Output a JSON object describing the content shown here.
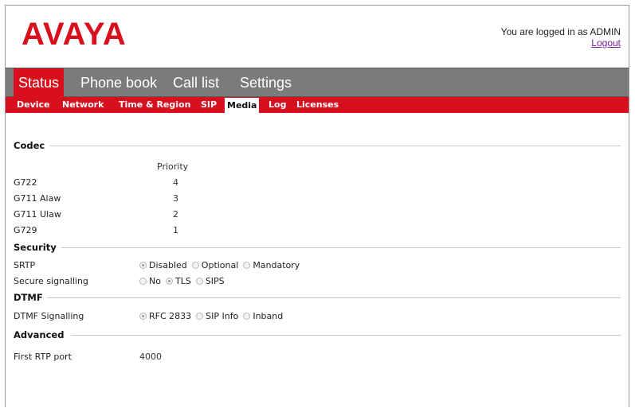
{
  "header": {
    "logo": "AVAYA",
    "login_text": "You are logged in as ADMIN",
    "logout": "Logout"
  },
  "main_tabs": [
    {
      "label": "Status",
      "active": true
    },
    {
      "label": "Phone book",
      "active": false
    },
    {
      "label": "Call list",
      "active": false
    },
    {
      "label": "Settings",
      "active": false
    }
  ],
  "sub_tabs": [
    {
      "label": "Device",
      "active": false
    },
    {
      "label": "Network",
      "active": false
    },
    {
      "label": "Time & Region",
      "active": false
    },
    {
      "label": "SIP",
      "active": false
    },
    {
      "label": "Media",
      "active": true
    },
    {
      "label": "Log",
      "active": false
    },
    {
      "label": "Licenses",
      "active": false
    }
  ],
  "codec": {
    "title": "Codec",
    "priority_header": "Priority",
    "rows": [
      {
        "name": "G722",
        "priority": "4"
      },
      {
        "name": "G711 Alaw",
        "priority": "3"
      },
      {
        "name": "G711 Ulaw",
        "priority": "2"
      },
      {
        "name": "G729",
        "priority": "1"
      }
    ]
  },
  "security": {
    "title": "Security",
    "srtp_label": "SRTP",
    "srtp_options": [
      {
        "label": "Disabled",
        "selected": true
      },
      {
        "label": "Optional",
        "selected": false
      },
      {
        "label": "Mandatory",
        "selected": false
      }
    ],
    "secure_label": "Secure signalling",
    "secure_options": [
      {
        "label": "No",
        "selected": false
      },
      {
        "label": "TLS",
        "selected": true
      },
      {
        "label": "SIPS",
        "selected": false
      }
    ]
  },
  "dtmf": {
    "title": "DTMF",
    "signalling_label": "DTMF Signalling",
    "options": [
      {
        "label": "RFC 2833",
        "selected": true
      },
      {
        "label": "SIP Info",
        "selected": false
      },
      {
        "label": "Inband",
        "selected": false
      }
    ]
  },
  "advanced": {
    "title": "Advanced",
    "rtp_label": "First RTP port",
    "rtp_value": "4000"
  }
}
